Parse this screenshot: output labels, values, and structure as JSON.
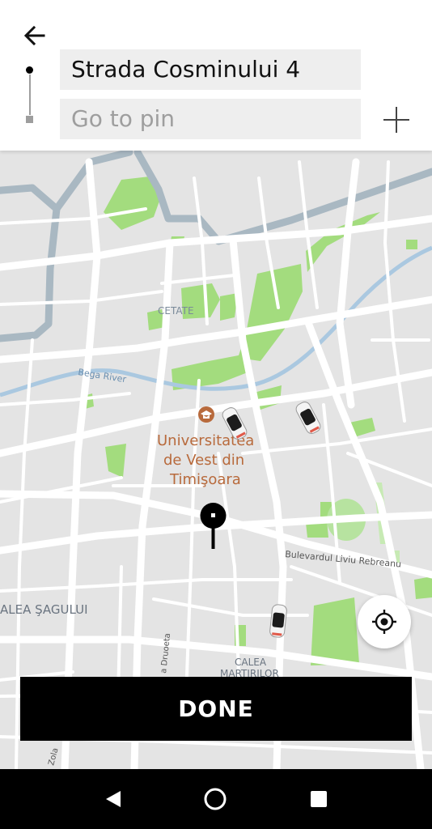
{
  "header": {
    "pickup_value": "Strada Cosminului 4",
    "destination_placeholder": "Go to pin"
  },
  "map": {
    "labels": {
      "district_cetate": "CETATE",
      "river": "Bega River",
      "poi_line1": "Universitatea",
      "poi_line2": "de Vest din",
      "poi_line3": "Timişoara",
      "street_rebreanu": "Bulevardul Liviu Rebreanu",
      "street_sagului": "ALEA ŞAGULUI",
      "street_calea_line1": "CALEA",
      "street_calea_line2": "MARTIRILOR",
      "street_druoeta": "a Druoeta",
      "street_zola": "Zola"
    },
    "colors": {
      "background": "#e4e4e4",
      "road": "#ffffff",
      "park": "#a3dc7e",
      "highway": "#a9b8c2",
      "river": "#aac8e0"
    }
  },
  "done_button": {
    "label": "DONE"
  },
  "icons": {
    "back": "arrow-left-icon",
    "add_stop": "plus-icon",
    "locate": "crosshair-icon",
    "pin": "map-pin-icon",
    "poi": "graduation-cap-icon",
    "nav_back": "triangle-back-icon",
    "nav_home": "circle-home-icon",
    "nav_recents": "square-recents-icon"
  }
}
